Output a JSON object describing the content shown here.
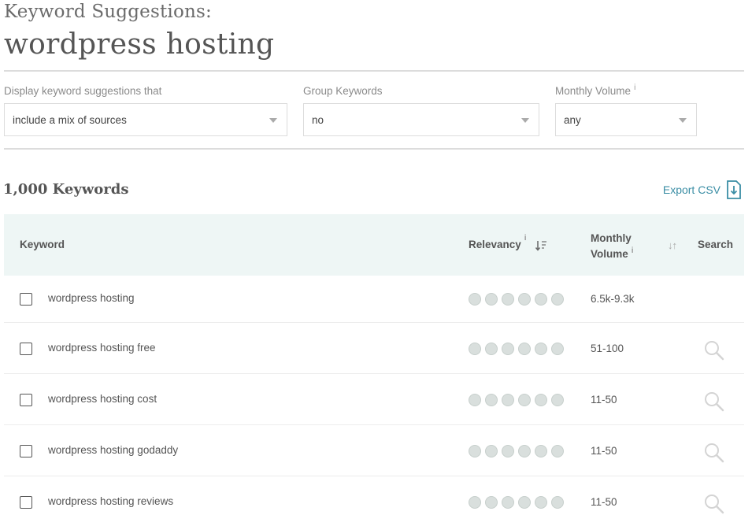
{
  "header": {
    "title": "Keyword Suggestions:",
    "seed": "wordpress hosting"
  },
  "filters": {
    "display": {
      "label": "Display keyword suggestions that",
      "value": "include a mix of sources"
    },
    "group": {
      "label": "Group Keywords",
      "value": "no"
    },
    "volume": {
      "label": "Monthly Volume",
      "info": "i",
      "value": "any"
    }
  },
  "summary": {
    "count": "1,000 Keywords",
    "export_label": "Export CSV"
  },
  "table": {
    "columns": {
      "keyword": "Keyword",
      "relevancy": "Relevancy",
      "relevancy_info": "i",
      "volume_line1": "Monthly",
      "volume_line2": "Volume",
      "volume_info": "i",
      "volume_sort": "↓↑",
      "search": "Search"
    },
    "rows": [
      {
        "keyword": "wordpress hosting",
        "volume": "6.5k-9.3k",
        "relevancy_dots": 6,
        "has_search": false
      },
      {
        "keyword": "wordpress hosting free",
        "volume": "51-100",
        "relevancy_dots": 6,
        "has_search": true
      },
      {
        "keyword": "wordpress hosting cost",
        "volume": "11-50",
        "relevancy_dots": 6,
        "has_search": true
      },
      {
        "keyword": "wordpress hosting godaddy",
        "volume": "11-50",
        "relevancy_dots": 6,
        "has_search": true
      },
      {
        "keyword": "wordpress hosting reviews",
        "volume": "11-50",
        "relevancy_dots": 6,
        "has_search": true
      }
    ]
  },
  "colors": {
    "accent": "#3b8ea5",
    "header_bg": "#eef6f5",
    "dot": "#d9dfdd"
  },
  "icons": {
    "export": "download-file-icon",
    "search": "magnifier-icon",
    "sort": "sort-descending-icon"
  }
}
